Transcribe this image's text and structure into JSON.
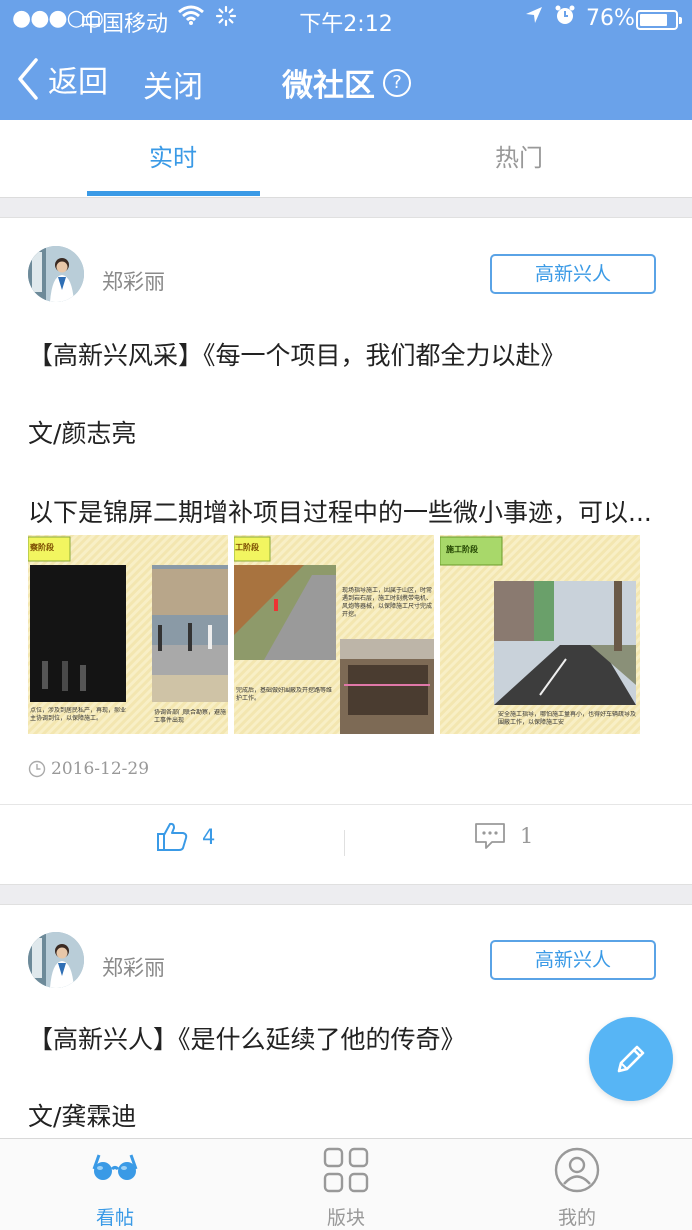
{
  "status_bar": {
    "signal": "●●●○○",
    "carrier": "中国移动",
    "time": "下午2:12",
    "battery": "76%"
  },
  "nav": {
    "back_label": "返回",
    "close_label": "关闭",
    "title": "微社区",
    "help_label": "?"
  },
  "tabs": [
    {
      "label": "实时",
      "active": true
    },
    {
      "label": "热门",
      "active": false
    }
  ],
  "posts": [
    {
      "author": "郑彩丽",
      "tag": "高新兴人",
      "lines": [
        "【高新兴风采】《每一个项目，我们都全力以赴》",
        "文/颜志亮",
        "以下是锦屏二期增补项目过程中的一些微小事迹，可以..."
      ],
      "images": [
        {
          "header": "察阶段",
          "caption": "点位，涉及到居民私产，再现，郝业主协调到位，以保障施工。",
          "caption_b": "协调各部门联合勘察，避施工事件出现"
        },
        {
          "header": "工阶段",
          "caption": "现场指导施工，因属于山区，时常遇到岩石层，施工时刻携带电机、风炮等器械，以保障施工尺寸完成开挖。",
          "caption_b": "完成后，基础做好围蔽及开挖路等维护工作。"
        },
        {
          "header": "施工阶段",
          "caption": "安全施工指导，哪怕施工量再小，也得好车辆疏导及围蔽工作，以保障施工安"
        }
      ],
      "date": "2016-12-29",
      "likes": "4",
      "comments": "1"
    },
    {
      "author": "郑彩丽",
      "tag": "高新兴人",
      "lines": [
        "【高新兴人】《是什么延续了他的传奇》",
        "文/龚霖迪"
      ]
    }
  ],
  "tabbar": [
    {
      "label": "看帖",
      "icon": "glasses-icon",
      "active": true
    },
    {
      "label": "版块",
      "icon": "grid-icon",
      "active": false
    },
    {
      "label": "我的",
      "icon": "user-icon",
      "active": false
    }
  ],
  "colors": {
    "header": "#6aa2ea",
    "accent": "#3a9ae6",
    "fab": "#57b5f5"
  }
}
